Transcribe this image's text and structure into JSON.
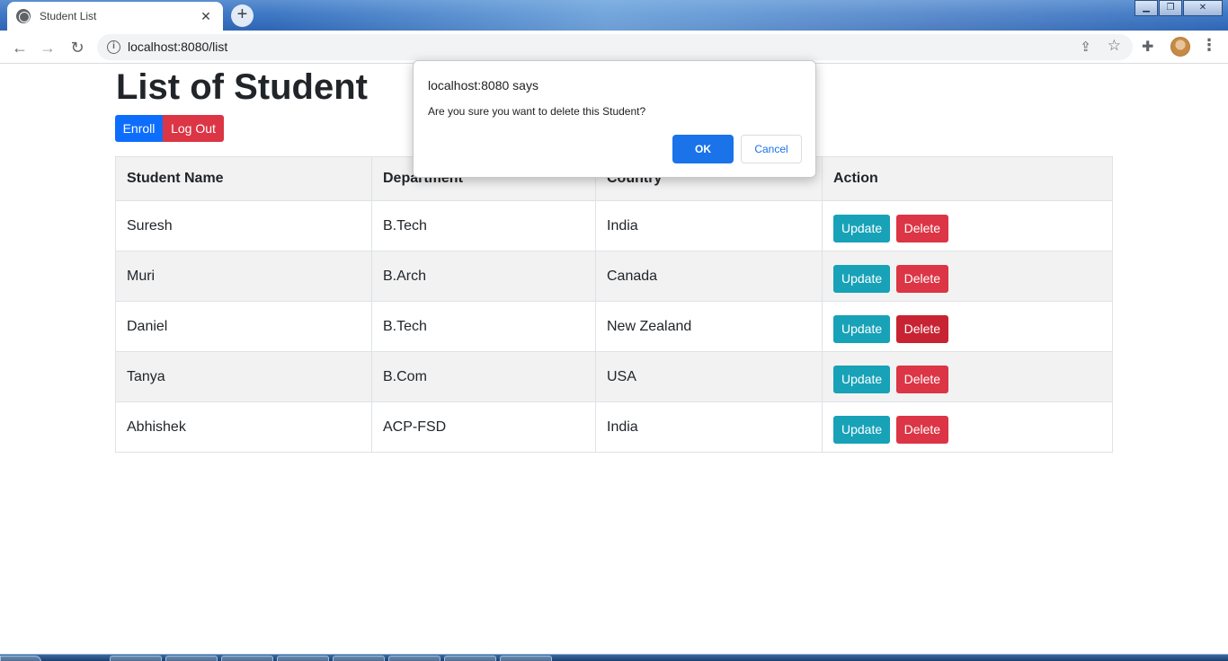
{
  "browser": {
    "tab_title": "Student List",
    "tab_close": "✕",
    "new_tab": "+",
    "url": "localhost:8080/list",
    "window_controls": [
      "minimize",
      "restore",
      "close"
    ]
  },
  "page": {
    "heading": "List of Student",
    "enroll_label": "Enroll",
    "logout_label": "Log Out"
  },
  "table": {
    "headers": [
      "Student Name",
      "Department",
      "Country",
      "Action"
    ],
    "rows": [
      {
        "name": "Suresh",
        "department": "B.Tech",
        "country": "India"
      },
      {
        "name": "Muri",
        "department": "B.Arch",
        "country": "Canada"
      },
      {
        "name": "Daniel",
        "department": "B.Tech",
        "country": "New Zealand"
      },
      {
        "name": "Tanya",
        "department": "B.Com",
        "country": "USA"
      },
      {
        "name": "Abhishek",
        "department": "ACP-FSD",
        "country": "India"
      }
    ],
    "update_label": "Update",
    "delete_label": "Delete"
  },
  "dialog": {
    "title": "localhost:8080 says",
    "message": "Are you sure you want to delete this Student?",
    "ok_label": "OK",
    "cancel_label": "Cancel"
  },
  "colors": {
    "primary": "#0d6efd",
    "danger": "#dc3545",
    "info": "#17a2b8",
    "dialog_ok": "#1a73e8"
  }
}
